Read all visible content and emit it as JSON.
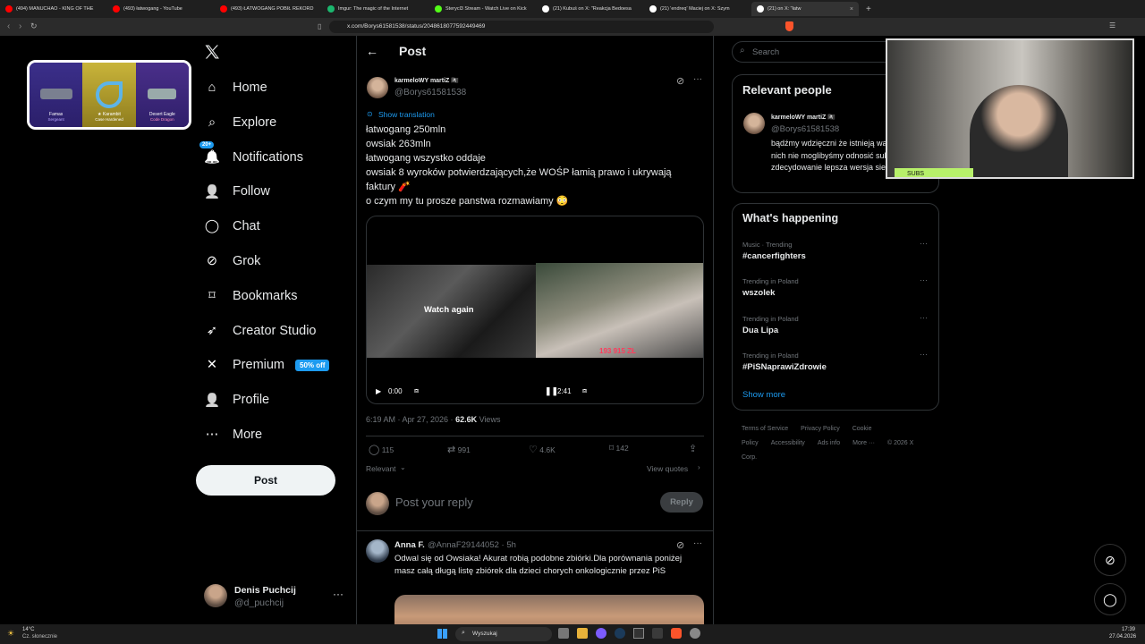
{
  "browser": {
    "tabs": [
      {
        "title": "(494) MANUCHAO - KING OF THE",
        "color": "#ff0000"
      },
      {
        "title": "(493) łatwogang - YouTube",
        "color": "#ff0000"
      },
      {
        "title": "(493) ŁATWOGANG POBIŁ REKORD",
        "color": "#ff0000"
      },
      {
        "title": "Imgur: The magic of the Internet",
        "color": "#1bb76e"
      },
      {
        "title": "Sterycl3 Stream - Watch Live on Kick",
        "color": "#53fc18"
      },
      {
        "title": "(21) Kubuś on X: \"Reakcja Bedoesa",
        "color": "#ffffff"
      },
      {
        "title": "(21) 'endreq' Maciej on X: Szym",
        "color": "#ffffff"
      },
      {
        "title": "(21) on X: \"łatw",
        "color": "#ffffff"
      }
    ],
    "url": "x.com/Borys61581538/status/2048618077592449469"
  },
  "nav": {
    "items": [
      {
        "label": "Home",
        "icon": "home-icon"
      },
      {
        "label": "Explore",
        "icon": "search-icon"
      },
      {
        "label": "Notifications",
        "icon": "bell-icon",
        "badge": "20+"
      },
      {
        "label": "Follow",
        "icon": "follow-icon"
      },
      {
        "label": "Chat",
        "icon": "chat-icon"
      },
      {
        "label": "Grok",
        "icon": "grok-icon"
      },
      {
        "label": "Bookmarks",
        "icon": "bookmark-icon"
      },
      {
        "label": "Creator Studio",
        "icon": "rocket-icon"
      },
      {
        "label": "Premium",
        "icon": "x-icon",
        "badge": "50% off"
      },
      {
        "label": "Profile",
        "icon": "person-icon"
      },
      {
        "label": "More",
        "icon": "more-icon"
      }
    ],
    "post_button": "Post",
    "user": {
      "name": "Denis Puchcij",
      "handle": "@d_puchcij"
    }
  },
  "overlay_skins": {
    "items": [
      {
        "name": "Famas",
        "sub": "Sergeant"
      },
      {
        "name": "★ Karambit",
        "sub": "Case Hardened"
      },
      {
        "name": "Desert Eagle",
        "sub": "Code Dragon"
      }
    ]
  },
  "post": {
    "header_title": "Post",
    "author_name": "karmeloWY martiZ 🏴‍☠️",
    "author_handle": "@Borys61581538",
    "show_translation": "Show translation",
    "lines": [
      "łatwogang 250mln",
      "owsiak 263mln",
      "łatwogang wszystko oddaje",
      "owsiak 8 wyroków potwierdzających,że WOŚP łamią prawo i ukrywają faktury 🧨",
      "o czym my tu prosze panstwa rozmawiamy 😳"
    ],
    "video": {
      "watch_again": "Watch again",
      "current_time": "0:00",
      "duration": "2:41",
      "overlay_number": "193 915 ZŁ"
    },
    "timestamp": "6:19 AM · Apr 27, 2026 · ",
    "views_count": "62.6K",
    "views_label": " Views",
    "stats": {
      "replies": "115",
      "reposts": "991",
      "likes": "4.6K",
      "bookmarks": "142"
    },
    "relevant_label": "Relevant",
    "view_quotes": "View quotes",
    "reply_placeholder": "Post your reply",
    "reply_button": "Reply"
  },
  "reply": {
    "name": "Anna F.",
    "handle": "@AnnaF29144052 · 5h",
    "text": "Odwal się od Owsiaka! Akurat robią podobne zbiórki.Dla porównania poniżej masz całą długą listę zbiórek dla dzieci chorych onkologicznie przez PiS"
  },
  "sidebar": {
    "search_placeholder": "Search",
    "relevant_title": "Relevant people",
    "relevant_person": {
      "name": "karmeloWY martiZ 🏴‍☠️",
      "handle": "@Borys61581538",
      "bio": "bądźmy wdzięczni że istnieją wariaci,bez nich nie moglibyśmy odnosić sukcesów .. zdecydowanie lepsza wersja siebie 😎💪"
    },
    "happening_title": "What's happening",
    "trends": [
      {
        "context": "Music · Trending",
        "name": "#cancerfighters"
      },
      {
        "context": "Trending in Poland",
        "name": "wszolek"
      },
      {
        "context": "Trending in Poland",
        "name": "Dua Lipa"
      },
      {
        "context": "Trending in Poland",
        "name": "#PiSNaprawiZdrowie"
      }
    ],
    "show_more": "Show more",
    "footer_links": [
      "Terms of Service",
      "Privacy Policy",
      "Cookie Policy",
      "Accessibility",
      "Ads info",
      "More ···",
      "© 2026 X Corp."
    ]
  },
  "webcam": {
    "label": "SUBS"
  },
  "taskbar": {
    "weather_temp": "14°C",
    "weather_desc": "Cz. słonecznie",
    "search": "Wyszukaj",
    "time": "17:39",
    "date": "27.04.2026"
  }
}
